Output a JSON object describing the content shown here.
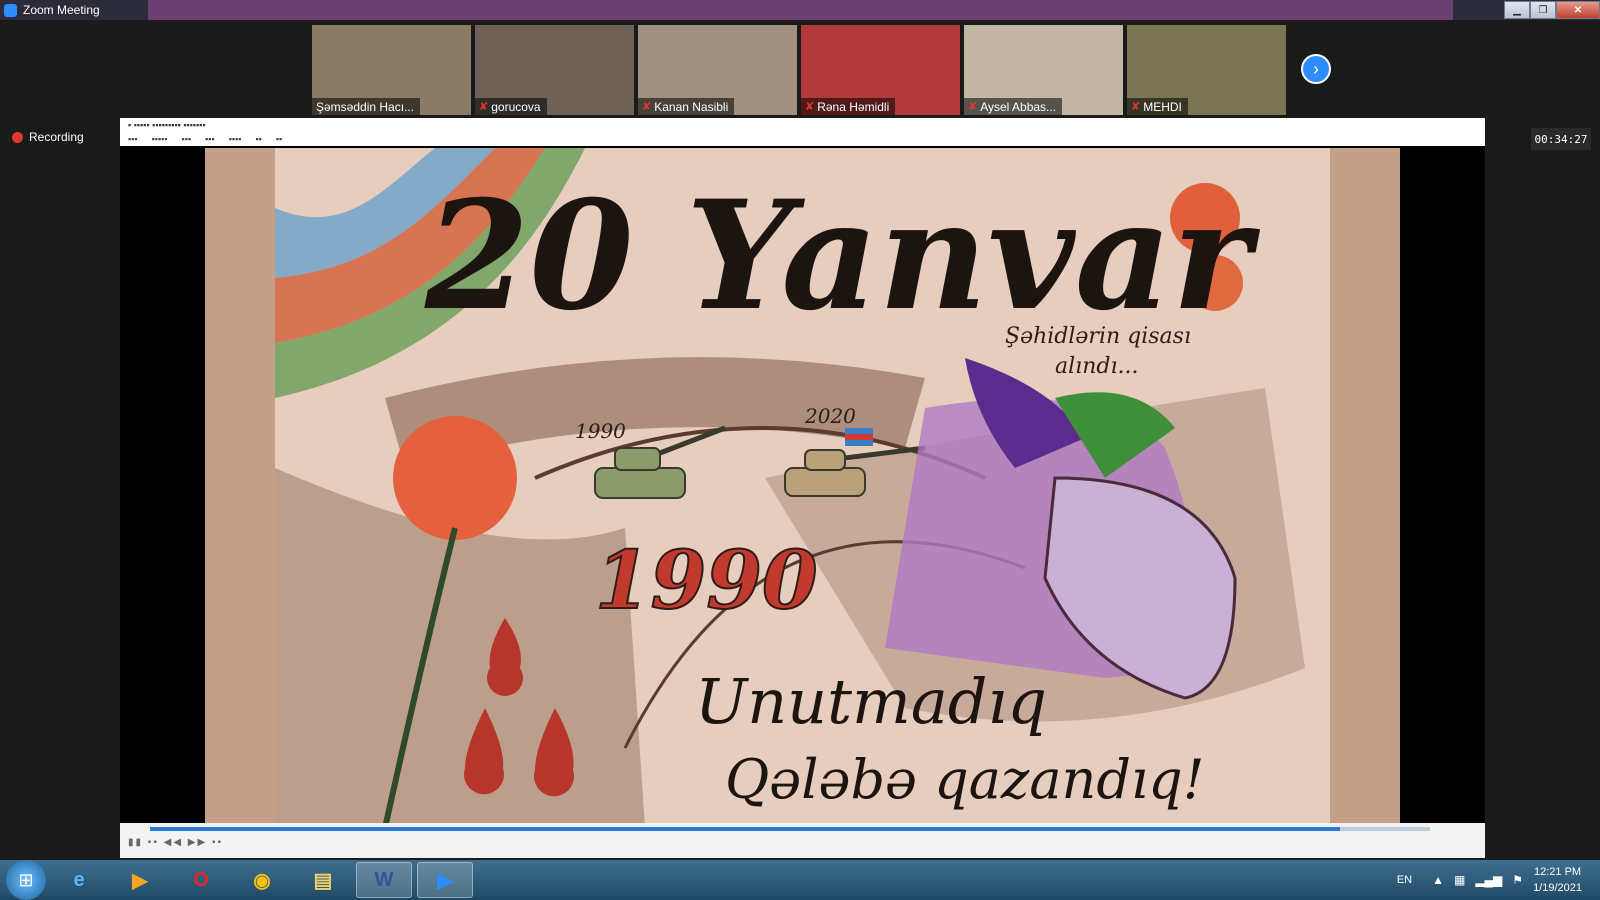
{
  "window": {
    "title": "Zoom Meeting"
  },
  "participants": [
    {
      "name": "Şəmsəddin Hacı...",
      "muted": false,
      "bg": "#8a7a66"
    },
    {
      "name": "gorucova",
      "muted": true,
      "bg": "#6e6258"
    },
    {
      "name": "Kanan Nasibli",
      "muted": true,
      "bg": "#a09080"
    },
    {
      "name": "Rəna Həmidli",
      "muted": true,
      "bg": "#b13a3a"
    },
    {
      "name": "Aysel Abbas...",
      "muted": true,
      "bg": "#c2b6a4"
    },
    {
      "name": "MEHDI",
      "muted": true,
      "bg": "#7a7552"
    }
  ],
  "recording_label": "Recording",
  "timer": "00:34:27",
  "playback_progress": 0.93,
  "drawing": {
    "headline": "20 Yanvar",
    "subtitle_line1": "Şəhidlərin qisası",
    "subtitle_line2": "alındı...",
    "year_left": "1990",
    "year_right": "2020",
    "year_center": "1990",
    "slogan_line1": "Unutmadıq",
    "slogan_line2": "Qələbə qazandıq!"
  },
  "taskbar": {
    "lang": "EN",
    "time": "12:21 PM",
    "date": "1/19/2021",
    "apps": [
      {
        "icon": "internet-explorer-icon",
        "glyph": "e",
        "color": "#5fb4ff",
        "active": false
      },
      {
        "icon": "media-player-icon",
        "glyph": "▶",
        "color": "#f5a623",
        "active": false
      },
      {
        "icon": "opera-icon",
        "glyph": "O",
        "color": "#e0282b",
        "active": false
      },
      {
        "icon": "chrome-icon",
        "glyph": "◉",
        "color": "#f4c20d",
        "active": false
      },
      {
        "icon": "file-explorer-icon",
        "glyph": "▤",
        "color": "#f2d06b",
        "active": false
      },
      {
        "icon": "word-icon",
        "glyph": "W",
        "color": "#2b5797",
        "active": true
      },
      {
        "icon": "zoom-icon",
        "glyph": "▶",
        "color": "#2d8cff",
        "active": true
      }
    ]
  }
}
